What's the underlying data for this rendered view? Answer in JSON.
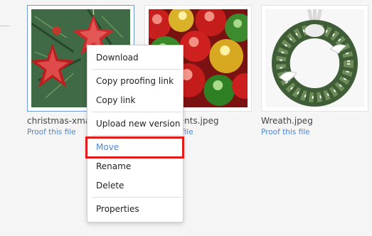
{
  "files": [
    {
      "name": "christmas-xmas",
      "link": "Proof this file",
      "selected": true
    },
    {
      "name": "s ornaments.jpeg",
      "link": "Proof this file",
      "selected": false
    },
    {
      "name": "Wreath.jpeg",
      "link": "Proof this file",
      "selected": false
    }
  ],
  "context_menu": {
    "items": [
      {
        "label": "Download"
      },
      {
        "label": "Copy proofing link"
      },
      {
        "label": "Copy link"
      },
      {
        "label": "Upload new version"
      },
      {
        "label": "Move",
        "highlighted": true
      },
      {
        "label": "Rename"
      },
      {
        "label": "Delete"
      },
      {
        "label": "Properties"
      }
    ]
  },
  "colors": {
    "accent": "#4a86d8",
    "highlight": "#e41b1b",
    "background": "#f5f5f5"
  }
}
